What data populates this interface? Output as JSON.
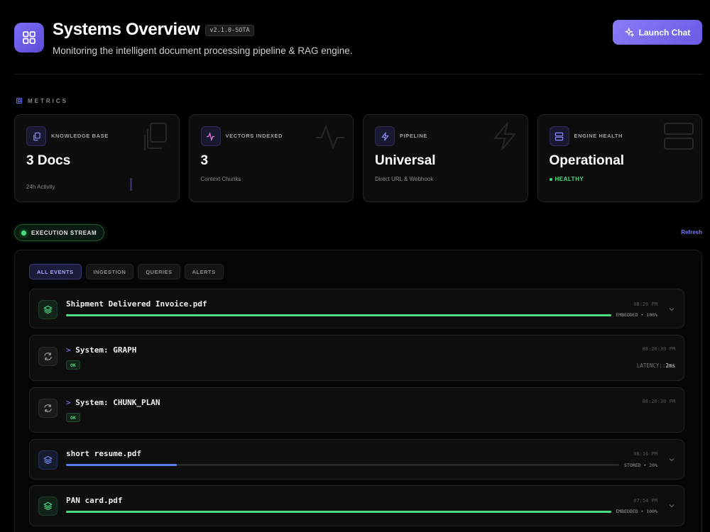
{
  "header": {
    "title": "Systems Overview",
    "version": "v2.1.0-SOTA",
    "subtitle": "Monitoring the intelligent document processing pipeline & RAG engine.",
    "launch_label": "Launch Chat"
  },
  "metrics": {
    "section_label": "METRICS",
    "cards": [
      {
        "label": "KNOWLEDGE BASE",
        "value": "3 Docs",
        "sub": "24h Activity",
        "icon": "documents-icon"
      },
      {
        "label": "VECTORS INDEXED",
        "value": "3",
        "sub": "Context Chunks",
        "icon": "activity-icon"
      },
      {
        "label": "PIPELINE",
        "value": "Universal",
        "sub": "Direct URL & Webhook",
        "icon": "zap-icon"
      },
      {
        "label": "ENGINE HEALTH",
        "value": "Operational",
        "sub": "HEALTHY",
        "icon": "server-icon"
      }
    ]
  },
  "stream": {
    "label": "EXECUTION STREAM",
    "refresh": "Refresh",
    "filters": [
      "ALL EVENTS",
      "INGESTION",
      "QUERIES",
      "ALERTS"
    ],
    "active_filter": "ALL EVENTS",
    "events": [
      {
        "type": "document",
        "title": "Shipment Delivered Invoice.pdf",
        "time": "08:20 PM",
        "status": "EMBEDDED • 100%",
        "progress": 1.0,
        "color": "#4ade80"
      },
      {
        "type": "system",
        "prompt": ">",
        "title": "System: GRAPH",
        "time": "08:20:30 PM",
        "badge": "OK",
        "latency_label": "LATENCY::",
        "latency_value": "2ms"
      },
      {
        "type": "system",
        "prompt": ">",
        "title": "System: CHUNK_PLAN",
        "time": "08:20:30 PM",
        "badge": "OK"
      },
      {
        "type": "document",
        "title": "short resume.pdf",
        "time": "08:16 PM",
        "status": "STORED • 20%",
        "progress": 0.2,
        "color": "#5b7cf0"
      },
      {
        "type": "document",
        "title": "PAN card.pdf",
        "time": "07:54 PM",
        "status": "EMBEDDED • 100%",
        "progress": 1.0,
        "color": "#4ade80"
      }
    ]
  }
}
